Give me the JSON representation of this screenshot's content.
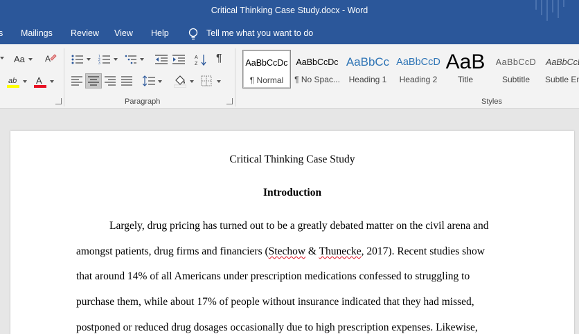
{
  "titlebar": {
    "title": "Critical Thinking Case Study.docx  -  Word"
  },
  "menu": {
    "items": [
      "s",
      "Mailings",
      "Review",
      "View",
      "Help"
    ],
    "tell_me": "Tell me what you want to do"
  },
  "ribbon": {
    "font_group": {
      "change_case_label": "Aa"
    },
    "paragraph_group": {
      "label": "Paragraph"
    },
    "styles_group": {
      "label": "Styles",
      "tiles": [
        {
          "sample": "AaBbCcDc",
          "name": "¶ Normal"
        },
        {
          "sample": "AaBbCcDc",
          "name": "¶ No Spac..."
        },
        {
          "sample": "AaBbCc",
          "name": "Heading 1"
        },
        {
          "sample": "AaBbCcD",
          "name": "Heading 2"
        },
        {
          "sample": "AaB",
          "name": "Title"
        },
        {
          "sample": "AaBbCcD",
          "name": "Subtitle"
        },
        {
          "sample": "AaBbCcL",
          "name": "Subtle Em"
        }
      ],
      "colors": {
        "heading": "#2e74b5",
        "normal": "#000000"
      }
    }
  },
  "document": {
    "title": "Critical Thinking Case Study",
    "heading": "Introduction",
    "line1": "Largely, drug pricing has turned out to be a greatly debated matter on the civil arena and",
    "line2_a": "amongst patients, drug firms and financiers (",
    "line2_err1": "Stechow",
    "line2_b": " & ",
    "line2_err2": "Thunecke",
    "line2_c": ", 2017). Recent studies show",
    "line3": "that around 14% of all Americans under prescription medications confessed to struggling to",
    "line4": "purchase them, while about 17% of people without insurance indicated that they had missed,",
    "line5": "postponed or reduced drug dosages occasionally due to high prescription expenses. Likewise,"
  },
  "colors": {
    "accent": "#2b579a",
    "font_color_bar": "#e81123",
    "highlight_bar": "#ffff00"
  }
}
